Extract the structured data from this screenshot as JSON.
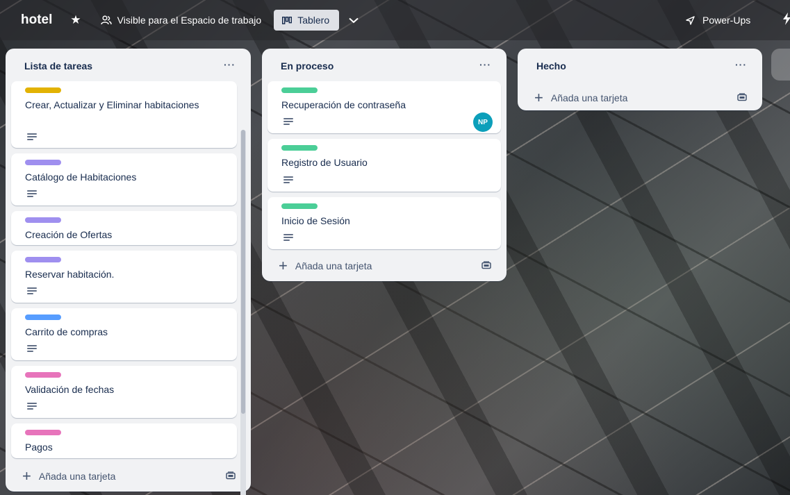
{
  "header": {
    "board_title": "hotel",
    "visibility_label": "Visible para el Espacio de trabajo",
    "view_label": "Tablero",
    "powerups_label": "Power-Ups"
  },
  "lists": [
    {
      "title": "Lista de tareas",
      "cards": [
        {
          "title": "Crear, Actualizar y Eliminar habitaciones",
          "label_color": "#e2b203",
          "has_description": true
        },
        {
          "title": "Catálogo de Habitaciones",
          "label_color": "#9f8fef",
          "has_description": true
        },
        {
          "title": "Creación de Ofertas",
          "label_color": "#9f8fef",
          "has_description": false
        },
        {
          "title": "Reservar habitación.",
          "label_color": "#9f8fef",
          "has_description": true
        },
        {
          "title": "Carrito de compras",
          "label_color": "#579dff",
          "has_description": true
        },
        {
          "title": "Validación de fechas",
          "label_color": "#e774bb",
          "has_description": true
        },
        {
          "title": "Pagos",
          "label_color": "#e774bb",
          "has_description": false
        }
      ],
      "add_card_label": "Añada una tarjeta"
    },
    {
      "title": "En proceso",
      "cards": [
        {
          "title": "Recuperación de contraseña",
          "label_color": "#4bce97",
          "has_description": true,
          "member_initials": "NP"
        },
        {
          "title": "Registro de Usuario",
          "label_color": "#4bce97",
          "has_description": true
        },
        {
          "title": "Inicio de Sesión",
          "label_color": "#4bce97",
          "has_description": true
        }
      ],
      "add_card_label": "Añada una tarjeta"
    },
    {
      "title": "Hecho",
      "cards": [],
      "add_card_label": "Añada una tarjeta"
    }
  ],
  "colors": {
    "avatar_bg": "#0c9fba",
    "list_bg": "#f1f2f4"
  }
}
